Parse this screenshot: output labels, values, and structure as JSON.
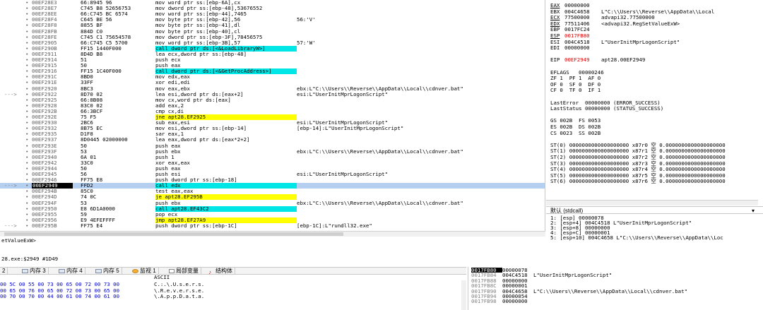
{
  "disasm": {
    "rows": [
      {
        "gutter": "",
        "addr": "00EF28E3",
        "bytes": "66:8945 96",
        "instr": "mov word ptr ss:[ebp-6A],cx",
        "cmt": ""
      },
      {
        "gutter": "",
        "addr": "00EF28E7",
        "bytes": "C745 B8 52656753",
        "instr": "mov dword ptr ss:[ebp-48],53676552",
        "cmt": ""
      },
      {
        "gutter": "",
        "addr": "00EF28EE",
        "bytes": "66:C745 BC 6574",
        "instr": "mov word ptr ss:[ebp-44],7465",
        "cmt": ""
      },
      {
        "gutter": "",
        "addr": "00EF28F4",
        "bytes": "C645 BE 56",
        "instr": "mov byte ptr ss:[ebp-42],56",
        "cmt": "56:'V'"
      },
      {
        "gutter": "",
        "addr": "00EF28F8",
        "bytes": "8855 BF",
        "instr": "mov byte ptr ss:[ebp-41],dl",
        "cmt": ""
      },
      {
        "gutter": "",
        "addr": "00EF28FB",
        "bytes": "884D C0",
        "instr": "mov byte ptr ss:[ebp-40],cl",
        "cmt": ""
      },
      {
        "gutter": "",
        "addr": "00EF28FE",
        "bytes": "C745 C1 75654578",
        "instr": "mov dword ptr ss:[ebp-3F],78456575",
        "cmt": ""
      },
      {
        "gutter": "",
        "addr": "00EF2905",
        "bytes": "66:C745 C5 5700",
        "instr": "mov word ptr ss:[ebp-3B],57",
        "cmt": "57:'W'"
      },
      {
        "gutter": "",
        "addr": "00EF290B",
        "bytes": "FF15 1440F000",
        "instr": "call dword ptr ds:[<&LoadLibraryW>]",
        "cmt": ""
      },
      {
        "gutter": "",
        "addr": "00EF2911",
        "bytes": "8D4D B8",
        "instr": "lea ecx,dword ptr ss:[ebp-48]",
        "cmt": ""
      },
      {
        "gutter": "",
        "addr": "00EF2914",
        "bytes": "51",
        "instr": "push ecx",
        "cmt": ""
      },
      {
        "gutter": "",
        "addr": "00EF2915",
        "bytes": "50",
        "instr": "push eax",
        "cmt": ""
      },
      {
        "gutter": "",
        "addr": "00EF2916",
        "bytes": "FF15 1C40F000",
        "instr": "call dword ptr ds:[<&GetProcAddress>]",
        "cmt": ""
      },
      {
        "gutter": "",
        "addr": "00EF291C",
        "bytes": "8BD0",
        "instr": "mov edx,eax",
        "cmt": ""
      },
      {
        "gutter": "",
        "addr": "00EF291E",
        "bytes": "33FF",
        "instr": "xor edi,edi",
        "cmt": ""
      },
      {
        "gutter": "",
        "addr": "00EF2920",
        "bytes": "8BC3",
        "instr": "mov eax,ebx",
        "cmt": "ebx:L\"C:\\\\Users\\\\Reverse\\\\AppData\\\\Local\\\\cdnver.bat\""
      },
      {
        "gutter": "--->",
        "addr": "00EF2922",
        "bytes": "8D70 02",
        "instr": "lea esi,dword ptr ds:[eax+2]",
        "cmt": "esi:L\"UserInitMprLogonScript\""
      },
      {
        "gutter": "",
        "addr": "00EF2925",
        "bytes": "66:8B08",
        "instr": "mov cx,word ptr ds:[eax]",
        "cmt": ""
      },
      {
        "gutter": "",
        "addr": "00EF2928",
        "bytes": "83C0 02",
        "instr": "add eax,2",
        "cmt": ""
      },
      {
        "gutter": "",
        "addr": "00EF292B",
        "bytes": "66:3BCF",
        "instr": "cmp cx,di",
        "cmt": ""
      },
      {
        "gutter": "",
        "addr": "00EF292E",
        "bytes": "75 F5",
        "instr": "jne apt28.EF2925",
        "cmt": ""
      },
      {
        "gutter": "",
        "addr": "00EF2930",
        "bytes": "2BC6",
        "instr": "sub eax,esi",
        "cmt": "esi:L\"UserInitMprLogonScript\""
      },
      {
        "gutter": "",
        "addr": "00EF2932",
        "bytes": "8B75 EC",
        "instr": "mov esi,dword ptr ss:[ebp-14]",
        "cmt": "[ebp-14]:L\"UserInitMprLogonScript\""
      },
      {
        "gutter": "",
        "addr": "00EF2935",
        "bytes": "D1F8",
        "instr": "sar eax,1",
        "cmt": ""
      },
      {
        "gutter": "",
        "addr": "00EF2937",
        "bytes": "8D0445 02000000",
        "instr": "lea eax,dword ptr ds:[eax*2+2]",
        "cmt": ""
      },
      {
        "gutter": "",
        "addr": "00EF293E",
        "bytes": "50",
        "instr": "push eax",
        "cmt": ""
      },
      {
        "gutter": "",
        "addr": "00EF293F",
        "bytes": "53",
        "instr": "push ebx",
        "cmt": "ebx:L\"C:\\\\Users\\\\Reverse\\\\AppData\\\\Local\\\\cdnver.bat\""
      },
      {
        "gutter": "",
        "addr": "00EF2940",
        "bytes": "6A 01",
        "instr": "push 1",
        "cmt": ""
      },
      {
        "gutter": "",
        "addr": "00EF2942",
        "bytes": "33C0",
        "instr": "xor eax,eax",
        "cmt": ""
      },
      {
        "gutter": "",
        "addr": "00EF2944",
        "bytes": "50",
        "instr": "push eax",
        "cmt": ""
      },
      {
        "gutter": "",
        "addr": "00EF2945",
        "bytes": "56",
        "instr": "push esi",
        "cmt": "esi:L\"UserInitMprLogonScript\""
      },
      {
        "gutter": "",
        "addr": "00EF2946",
        "bytes": "FF75 E8",
        "instr": "push dword ptr ss:[ebp-18]",
        "cmt": ""
      },
      {
        "gutter": "--->",
        "addr": "00EF2949",
        "bytes": "FFD2",
        "instr": "call edx",
        "cmt": "",
        "selected": true
      },
      {
        "gutter": "",
        "addr": "00EF294B",
        "bytes": "85C0",
        "instr": "test eax,eax",
        "cmt": ""
      },
      {
        "gutter": "",
        "addr": "00EF294D",
        "bytes": "74 0C",
        "instr": "je apt28.EF295B",
        "cmt": ""
      },
      {
        "gutter": "",
        "addr": "00EF294F",
        "bytes": "53",
        "instr": "push ebx",
        "cmt": "ebx:L\"C:\\\\Users\\\\Reverse\\\\AppData\\\\Local\\\\cdnver.bat\""
      },
      {
        "gutter": "",
        "addr": "00EF2950",
        "bytes": "E8 6D1A0000",
        "instr": "call apt28.EF43C2",
        "cmt": ""
      },
      {
        "gutter": "",
        "addr": "00EF2955",
        "bytes": "59",
        "instr": "pop ecx",
        "cmt": ""
      },
      {
        "gutter": "",
        "addr": "00EF2956",
        "bytes": "E9 4EFEFFFF",
        "instr": "jmp apt28.EF27A9",
        "cmt": ""
      },
      {
        "gutter": "--->",
        "addr": "00EF295B",
        "bytes": "FF75 E4",
        "instr": "push dword ptr ss:[ebp-1C]",
        "cmt": "[ebp-1C]:L\"rundll32.exe\""
      }
    ]
  },
  "status": {
    "line1": "etValueExW>",
    "line2": "28.exe:$2949 #1D49"
  },
  "registers": {
    "rows": [
      {
        "name": "EAX",
        "value": "00000000",
        "comment": "",
        "u": true
      },
      {
        "name": "EBX",
        "value": "004C4658",
        "comment": "L\"C:\\\\Users\\\\Reverse\\\\AppData\\\\Local"
      },
      {
        "name": "ECX",
        "value": "77500000",
        "comment": "advapi32.77500000",
        "u": true
      },
      {
        "name": "EDX",
        "value": "77511406",
        "comment": "<advapi32.RegSetValueExW>",
        "u": true
      },
      {
        "name": "EBP",
        "value": "0017FC24",
        "comment": ""
      },
      {
        "name": "ESP",
        "value": "0017FB80",
        "comment": "",
        "red": true,
        "u": true
      },
      {
        "name": "ESI",
        "value": "004C4518",
        "comment": "L\"UserInitMprLogonScript\""
      },
      {
        "name": "EDI",
        "value": "00000000",
        "comment": ""
      },
      {
        "name": "",
        "value": "",
        "comment": ""
      },
      {
        "name": "EIP",
        "value": "00EF2949",
        "comment": "apt28.00EF2949",
        "red": true
      },
      {
        "name": "",
        "value": "",
        "comment": ""
      },
      {
        "name": "",
        "value": "",
        "comment": "",
        "raw": "EFLAGS   00000246"
      },
      {
        "name": "",
        "value": "",
        "comment": "",
        "raw": "ZF 1  PF 1  AF 0"
      },
      {
        "name": "",
        "value": "",
        "comment": "",
        "raw": "OF 0  SF 0  DF 0"
      },
      {
        "name": "",
        "value": "",
        "comment": "",
        "raw": "CF 0  TF 0  IF 1"
      },
      {
        "name": "",
        "value": "",
        "comment": ""
      },
      {
        "name": "",
        "value": "",
        "comment": "",
        "raw": "LastError  00000000 (ERROR_SUCCESS)"
      },
      {
        "name": "",
        "value": "",
        "comment": "",
        "raw": "LastStatus 00000000 (STATUS_SUCCESS)"
      },
      {
        "name": "",
        "value": "",
        "comment": ""
      },
      {
        "name": "",
        "value": "",
        "comment": "",
        "raw": "GS 002B  FS 0053"
      },
      {
        "name": "",
        "value": "",
        "comment": "",
        "raw": "ES 002B  DS 002B"
      },
      {
        "name": "",
        "value": "",
        "comment": "",
        "raw": "CS 0023  SS 002B"
      },
      {
        "name": "",
        "value": "",
        "comment": ""
      },
      {
        "name": "",
        "value": "",
        "comment": "",
        "raw": "ST(0) 0000000000000000000 x87r0 空 0.0000000000000000000"
      },
      {
        "name": "",
        "value": "",
        "comment": "",
        "raw": "ST(1) 0000000000000000000 x87r1 空 0.0000000000000000000"
      },
      {
        "name": "",
        "value": "",
        "comment": "",
        "raw": "ST(2) 0000000000000000000 x87r2 空 0.0000000000000000000"
      },
      {
        "name": "",
        "value": "",
        "comment": "",
        "raw": "ST(3) 0000000000000000000 x87r3 空 0.0000000000000000000"
      },
      {
        "name": "",
        "value": "",
        "comment": "",
        "raw": "ST(4) 0000000000000000000 x87r4 空 0.0000000000000000000"
      },
      {
        "name": "",
        "value": "",
        "comment": "",
        "raw": "ST(5) 0000000000000000000 x87r5 空 0.0000000000000000000"
      },
      {
        "name": "",
        "value": "",
        "comment": "",
        "raw": "ST(6) 0000000000000000000 x87r6 空 0.0000000000000000000"
      }
    ]
  },
  "callconv": {
    "label": "默认 (stdcall)",
    "dropdown": "▾"
  },
  "args": [
    "1: [esp] 00000078",
    "2: [esp+4] 004C4518 L\"UserInitMprLogonScript\"",
    "3: [esp+8] 00000000",
    "4: [esp+C] 00000001",
    "5: [esp+10] 004C4658 L\"C:\\\\Users\\\\Reverse\\\\AppData\\\\Loc"
  ],
  "tabs": [
    {
      "label": "2"
    },
    {
      "label": "内存 3"
    },
    {
      "label": "内存 4"
    },
    {
      "label": "内存 5"
    },
    {
      "label": "监视 1"
    },
    {
      "label": "局部变量"
    },
    {
      "label": "结构体"
    }
  ],
  "dump": {
    "header": "ASCII",
    "rows": [
      {
        "hex": "00 5C 00 55 00 73 00 65 00 72 00 73 00",
        "asc": "C.:.\\.U.s.e.r.s."
      },
      {
        "hex": "00 65 00 76 00 65 00 72 00 73 00 65 00",
        "asc": "\\.R.e.v.e.r.s.e."
      },
      {
        "hex": "00 70 00 70 00 44 00 61 00 74 00 61 00",
        "asc": "\\.A.p.p.D.a.t.a."
      }
    ]
  },
  "stack": {
    "rows": [
      {
        "addr": "0017FB80",
        "val": "00000078",
        "cmt": "",
        "top": true
      },
      {
        "addr": "0017FB84",
        "val": "004C4518",
        "cmt": "L\"UserInitMprLogonScript\""
      },
      {
        "addr": "0017FB88",
        "val": "00000000",
        "cmt": ""
      },
      {
        "addr": "0017FB8C",
        "val": "00000001",
        "cmt": ""
      },
      {
        "addr": "0017FB90",
        "val": "004C4658",
        "cmt": "L\"C:\\\\Users\\\\Reverse\\\\AppData\\\\Local\\\\cdnver.bat\""
      },
      {
        "addr": "0017FB94",
        "val": "00000054",
        "cmt": ""
      },
      {
        "addr": "0017FB98",
        "val": "00000000",
        "cmt": ""
      }
    ]
  }
}
